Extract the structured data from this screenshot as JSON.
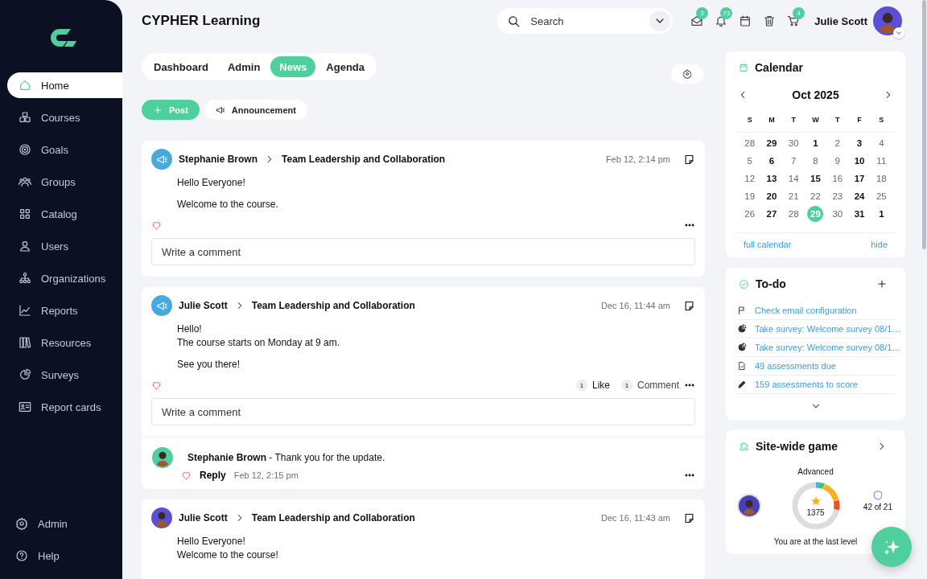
{
  "app": {
    "title": "CYPHER Learning"
  },
  "sidebar": {
    "items": [
      {
        "kind": "home",
        "label": "Home",
        "selected": true
      },
      {
        "kind": "courses",
        "label": "Courses",
        "selected": false
      },
      {
        "kind": "goals",
        "label": "Goals",
        "selected": false
      },
      {
        "kind": "groups",
        "label": "Groups",
        "selected": false
      },
      {
        "kind": "catalog",
        "label": "Catalog",
        "selected": false
      },
      {
        "kind": "users",
        "label": "Users",
        "selected": false
      },
      {
        "kind": "organizations",
        "label": "Organizations",
        "selected": false
      },
      {
        "kind": "reports",
        "label": "Reports",
        "selected": false
      },
      {
        "kind": "resources",
        "label": "Resources",
        "selected": false
      },
      {
        "kind": "surveys",
        "label": "Surveys",
        "selected": false
      },
      {
        "kind": "reportcards",
        "label": "Report cards",
        "selected": false
      }
    ],
    "footer_items": [
      {
        "kind": "settings",
        "label": "Admin"
      },
      {
        "kind": "help",
        "label": "Help"
      }
    ]
  },
  "header": {
    "search": {
      "placeholder": "Search"
    },
    "icons": [
      {
        "kind": "mail",
        "badge": "2"
      },
      {
        "kind": "bell",
        "badge": "73"
      },
      {
        "kind": "calendar"
      },
      {
        "kind": "trash"
      },
      {
        "kind": "cart",
        "badge": "4"
      }
    ],
    "user": {
      "name": "Julie Scott"
    }
  },
  "tabs": [
    {
      "label": "Dashboard",
      "selected": false
    },
    {
      "label": "Admin",
      "selected": false
    },
    {
      "label": "News",
      "selected": true
    },
    {
      "label": "Agenda",
      "selected": false
    }
  ],
  "actions": [
    {
      "kind": "primary",
      "label": "Post"
    },
    {
      "kind": "secondary",
      "label": "Announcement"
    }
  ],
  "posts": [
    {
      "kind": "announcement",
      "author": "Stephanie Brown",
      "course": "Team Leadership and Collaboration",
      "time": "Feb 12, 2:14 pm",
      "body": [
        "Hello Everyone!",
        "Welcome to the course."
      ],
      "liked": false,
      "comment_placeholder": "Write a comment"
    },
    {
      "kind": "announcement",
      "author": "Julie Scott",
      "course": "Team Leadership and Collaboration",
      "time": "Dec 16, 11:44 am",
      "body": [
        "Hello!\nThe course starts on Monday at 9 am.",
        "See you there!"
      ],
      "liked": false,
      "likes": {
        "count": "1",
        "label": "Like"
      },
      "comment_count": {
        "count": "1",
        "label": "Comment"
      },
      "comment_placeholder": "Write a comment",
      "comments": [
        {
          "text": "**Stephanie Brown** - Thank you for the update.",
          "liked": false,
          "reply": "Reply",
          "time": "Feb 12, 2:15 pm"
        }
      ]
    },
    {
      "kind": "photo",
      "author": "Julie Scott",
      "course": "Team Leadership and Collaboration",
      "time": "Dec 16, 11:43 am",
      "body": [
        "Hello Everyone!\nWelcome to the course!"
      ]
    }
  ],
  "calendar": {
    "title": "Calendar",
    "month": "Oct 2025",
    "weekdays": [
      "S",
      "M",
      "T",
      "W",
      "T",
      "F",
      "S"
    ],
    "weeks": [
      [
        {
          "day": "28",
          "has_events": false,
          "selected": false
        },
        {
          "day": "29",
          "has_events": true,
          "selected": false
        },
        {
          "day": "30",
          "has_events": false,
          "selected": false
        },
        {
          "day": "1",
          "has_events": true,
          "selected": false
        },
        {
          "day": "2",
          "has_events": false,
          "selected": false
        },
        {
          "day": "3",
          "has_events": true,
          "selected": false
        },
        {
          "day": "4",
          "has_events": false,
          "selected": false
        }
      ],
      [
        {
          "day": "5",
          "has_events": false,
          "selected": false
        },
        {
          "day": "6",
          "has_events": true,
          "selected": false
        },
        {
          "day": "7",
          "has_events": false,
          "selected": false
        },
        {
          "day": "8",
          "has_events": false,
          "selected": false
        },
        {
          "day": "9",
          "has_events": false,
          "selected": false
        },
        {
          "day": "10",
          "has_events": true,
          "selected": false
        },
        {
          "day": "11",
          "has_events": false,
          "selected": false
        }
      ],
      [
        {
          "day": "12",
          "has_events": false,
          "selected": false
        },
        {
          "day": "13",
          "has_events": true,
          "selected": false
        },
        {
          "day": "14",
          "has_events": false,
          "selected": false
        },
        {
          "day": "15",
          "has_events": true,
          "selected": false
        },
        {
          "day": "16",
          "has_events": false,
          "selected": false
        },
        {
          "day": "17",
          "has_events": true,
          "selected": false
        },
        {
          "day": "18",
          "has_events": false,
          "selected": false
        }
      ],
      [
        {
          "day": "19",
          "has_events": false,
          "selected": false
        },
        {
          "day": "20",
          "has_events": true,
          "selected": false
        },
        {
          "day": "21",
          "has_events": false,
          "selected": false
        },
        {
          "day": "22",
          "has_events": false,
          "selected": false
        },
        {
          "day": "23",
          "has_events": false,
          "selected": false
        },
        {
          "day": "24",
          "has_events": true,
          "selected": false
        },
        {
          "day": "25",
          "has_events": false,
          "selected": false
        }
      ],
      [
        {
          "day": "26",
          "has_events": false,
          "selected": false
        },
        {
          "day": "27",
          "has_events": true,
          "selected": false
        },
        {
          "day": "28",
          "has_events": false,
          "selected": false
        },
        {
          "day": "29",
          "has_events": false,
          "selected": true
        },
        {
          "day": "30",
          "has_events": false,
          "selected": false
        },
        {
          "day": "31",
          "has_events": true,
          "selected": false
        },
        {
          "day": "1",
          "has_events": true,
          "selected": false
        }
      ]
    ],
    "full_link": "full calendar",
    "hide_link": "hide"
  },
  "todo": {
    "title": "To-do",
    "items": [
      {
        "kind": "flag",
        "label": "Check email configuration"
      },
      {
        "kind": "survey",
        "label": "Take survey: Welcome survey 08/1…"
      },
      {
        "kind": "survey",
        "label": "Take survey: Welcome survey 08/1…"
      },
      {
        "kind": "document",
        "label": "49 assessments due"
      },
      {
        "kind": "pencil",
        "label": "159 assessments to score"
      }
    ]
  },
  "game": {
    "title": "Site-wide game",
    "level_name": "Advanced",
    "points": "1375",
    "badge": "42 of 21",
    "status": "You are at the last level"
  }
}
